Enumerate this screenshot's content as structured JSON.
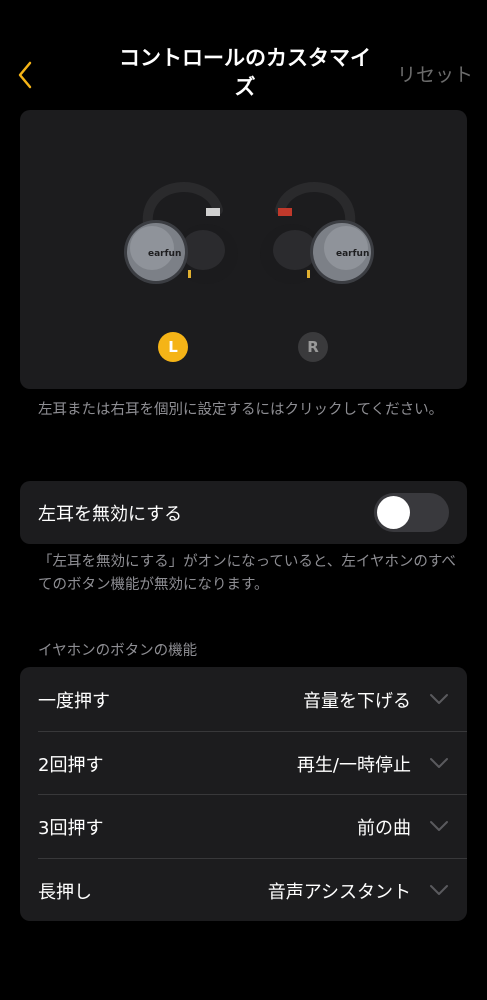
{
  "header": {
    "title": "コントロールのカスタマイズ",
    "reset_label": "リセット"
  },
  "earbuds": {
    "left_badge": "L",
    "right_badge": "R",
    "brand_text": "earfun",
    "selected": "L",
    "hint": "左耳または右耳を個別に設定するにはクリックしてください。"
  },
  "disable_left": {
    "label": "左耳を無効にする",
    "enabled": false,
    "hint": "「左耳を無効にする」がオンになっていると、左イヤホンのすべてのボタン機能が無効になります。"
  },
  "button_functions": {
    "section_label": "イヤホンのボタンの機能",
    "rows": [
      {
        "name": "一度押す",
        "value": "音量を下げる"
      },
      {
        "name": "2回押す",
        "value": "再生/一時停止"
      },
      {
        "name": "3回押す",
        "value": "前の曲"
      },
      {
        "name": "長押し",
        "value": "音声アシスタント"
      }
    ]
  },
  "colors": {
    "accent": "#f5b417",
    "background": "#000000",
    "card": "#1c1c1e"
  }
}
